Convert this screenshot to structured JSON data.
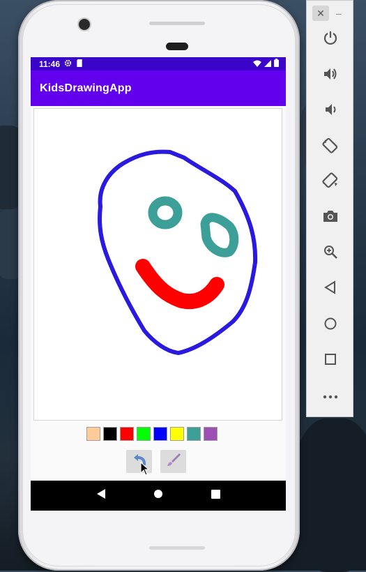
{
  "device": {
    "status_bar": {
      "time": "11:46",
      "icons": [
        "gear-icon",
        "sd-card-icon",
        "wifi-icon",
        "signal-icon",
        "battery-icon"
      ]
    },
    "app_bar": {
      "title": "KidsDrawingApp",
      "color": "#6200ee"
    },
    "status_bar_color": "#3a05c8",
    "palette": [
      {
        "name": "skin",
        "color": "#ffcc99"
      },
      {
        "name": "black",
        "color": "#000000"
      },
      {
        "name": "red",
        "color": "#ff0000"
      },
      {
        "name": "green",
        "color": "#00ff00"
      },
      {
        "name": "blue",
        "color": "#0000ff"
      },
      {
        "name": "yellow",
        "color": "#ffff00"
      },
      {
        "name": "teal",
        "color": "#3da098"
      },
      {
        "name": "purple",
        "color": "#9c4fb5"
      }
    ],
    "tools": [
      {
        "name": "undo-icon"
      },
      {
        "name": "brush-icon"
      }
    ],
    "nav_bar": [
      "back-icon",
      "home-icon",
      "recents-icon"
    ]
  },
  "drawing": {
    "strokes": [
      {
        "shape": "face-outline",
        "color": "#2a1ae0"
      },
      {
        "shape": "left-eye",
        "color": "#3da098"
      },
      {
        "shape": "right-eye",
        "color": "#3da098"
      },
      {
        "shape": "smile",
        "color": "#ff0000"
      }
    ]
  },
  "emulator_toolbar": {
    "window_controls": {
      "close": "✕",
      "minimize": "–"
    },
    "buttons": [
      "power-icon",
      "volume-up-icon",
      "volume-down-icon",
      "rotate-left-icon",
      "rotate-right-icon",
      "camera-icon",
      "zoom-icon",
      "back-icon",
      "home-icon",
      "overview-icon",
      "more-icon"
    ]
  }
}
